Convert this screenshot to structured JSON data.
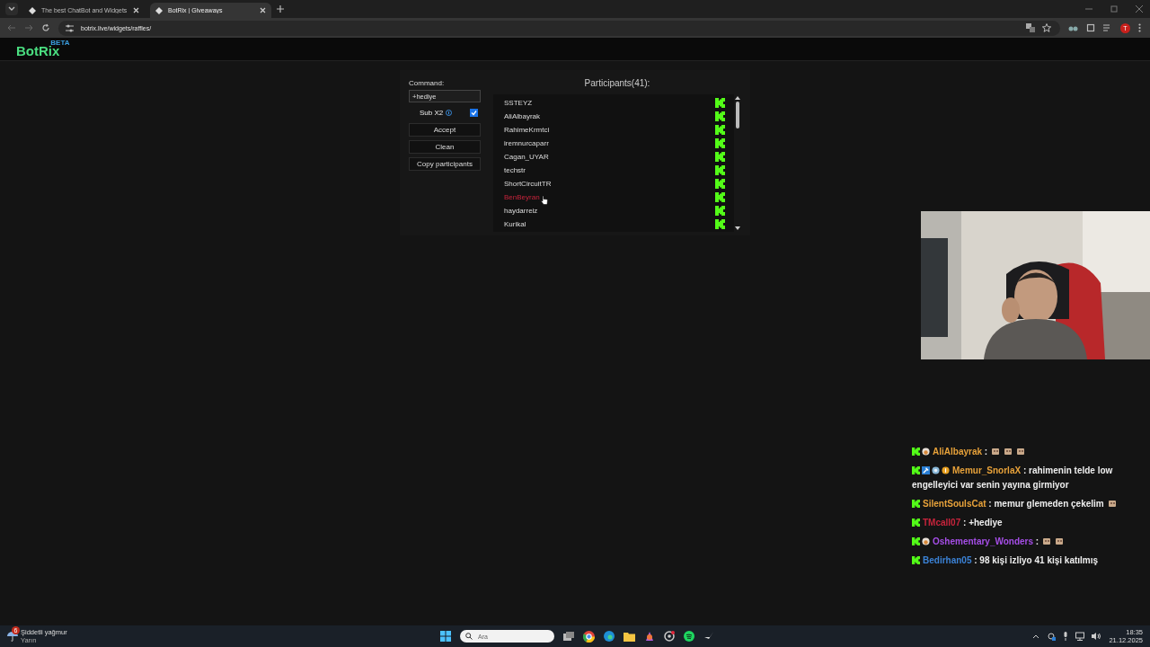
{
  "browser": {
    "tabs": [
      {
        "title": "The best ChatBot and Widgets",
        "selected": false
      },
      {
        "title": "BotRix | Giveaways",
        "selected": true
      }
    ],
    "url": "botrix.live/widgets/raffles/",
    "profile_initial": "T"
  },
  "header": {
    "logo": "BotRix",
    "badge": "BETA"
  },
  "raffle": {
    "command_label": "Command:",
    "command_value": "+hediye",
    "sub_label": "Sub X2",
    "sub_checked": true,
    "buttons": [
      "Accept",
      "Clean",
      "Copy participants"
    ],
    "participants_title": "Participants(41):",
    "participants": [
      {
        "name": "SSTEYZ",
        "hovered": false
      },
      {
        "name": "AliAlbayrak",
        "hovered": false
      },
      {
        "name": "RahimeKrmtci",
        "hovered": false
      },
      {
        "name": "iremnurcaparr",
        "hovered": false
      },
      {
        "name": "Cagan_UYAR",
        "hovered": false
      },
      {
        "name": "techstr",
        "hovered": false
      },
      {
        "name": "ShortCircuitTR",
        "hovered": false
      },
      {
        "name": "BenBeyran",
        "hovered": true
      },
      {
        "name": "haydarreiz",
        "hovered": false
      },
      {
        "name": "Kurikal",
        "hovered": false
      }
    ]
  },
  "chat": [
    {
      "badges": [
        {
          "kind": "kick"
        },
        {
          "kind": "emoji"
        }
      ],
      "user": "AliAlbayrak",
      "color": "#e8a23a",
      "text": ":",
      "emotes": [
        {
          "kind": "emote"
        },
        {
          "kind": "emote"
        },
        {
          "kind": "emote"
        }
      ]
    },
    {
      "badges": [
        {
          "kind": "kick"
        },
        {
          "kind": "tool"
        },
        {
          "kind": "globe"
        },
        {
          "kind": "coin"
        }
      ],
      "user": "Memur_SnorlaX",
      "color": "#e8a23a",
      "text": ": rahimenin telde low",
      "text_continued": "engelleyici var senin yayına girmiyor"
    },
    {
      "badges": [
        {
          "kind": "kick"
        }
      ],
      "user": "SilentSoulsCat",
      "color": "#e8a23a",
      "text": ": memur glemeden çekelim",
      "emotes": [
        {
          "kind": "emote"
        }
      ]
    },
    {
      "badges": [
        {
          "kind": "kick"
        }
      ],
      "user": "TMcall07",
      "color": "#c8243c",
      "text": ": +hediye"
    },
    {
      "badges": [
        {
          "kind": "kick"
        },
        {
          "kind": "emoji"
        }
      ],
      "user": "Oshementary_Wonders",
      "color": "#a64ee8",
      "text": ":",
      "emotes": [
        {
          "kind": "emote"
        },
        {
          "kind": "emote"
        }
      ]
    },
    {
      "badges": [
        {
          "kind": "kick"
        }
      ],
      "user": "Bedirhan05",
      "color": "#3b82d6",
      "text": ": 98 kişi izliyo 41 kişi katılmış"
    }
  ],
  "taskbar": {
    "weather": "Şiddetli yağmur",
    "weather_sub": "Yarın",
    "weather_badge": "6",
    "search_placeholder": "Ara",
    "time": "18:35",
    "date": "21.12.2025"
  }
}
